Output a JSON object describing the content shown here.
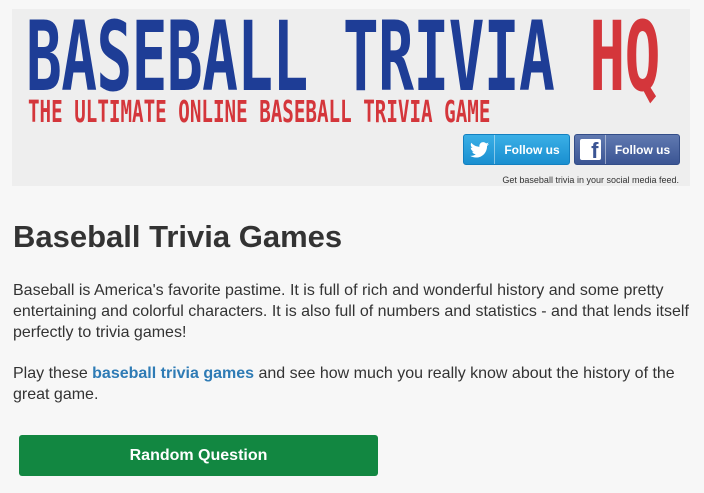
{
  "header": {
    "logo_title": "BASEBALL TRIVIA ",
    "logo_title_accent": "HQ",
    "logo_tagline": "THE ULTIMATE ONLINE BASEBALL TRIVIA GAME",
    "twitter_label": "Follow us",
    "facebook_label": "Follow us",
    "facebook_glyph": "f",
    "social_caption": "Get baseball trivia in your social media feed.",
    "colors": {
      "logo_blue": "#1e3d96",
      "logo_red": "#d4363b",
      "twitter": "#1da1f2",
      "facebook": "#3b5594"
    },
    "icons": {
      "twitter": "twitter-bird-icon",
      "facebook": "facebook-icon"
    }
  },
  "main": {
    "heading": "Baseball Trivia Games",
    "intro": "Baseball is America's favorite pastime. It is full of rich and wonderful history and some pretty entertaining and colorful characters. It is also full of numbers and statistics - and that lends itself perfectly to trivia games!",
    "play_prefix": "Play these ",
    "play_link": "baseball trivia games",
    "play_suffix": " and see how much you really know about the history of the great game.",
    "random_button": "Random Question",
    "colors": {
      "link": "#2e7bb5",
      "button": "#128741"
    }
  }
}
